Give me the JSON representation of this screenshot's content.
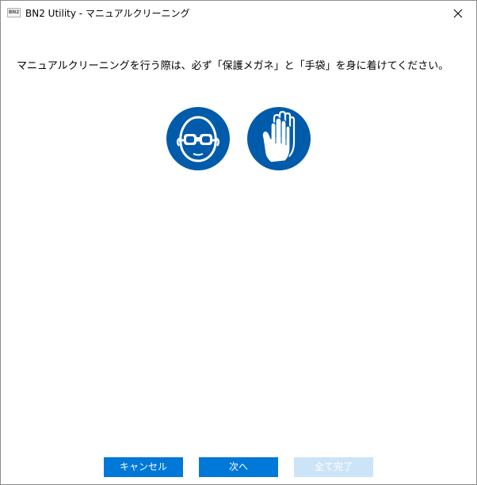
{
  "window": {
    "icon_text": "BN2",
    "title": "BN2 Utility - マニュアルクリーニング"
  },
  "main": {
    "instruction": "マニュアルクリーニングを行う際は、必ず「保護メガネ」と「手袋」を身に着けてください。",
    "icons": [
      {
        "name": "safety-goggles-icon"
      },
      {
        "name": "protective-gloves-icon"
      }
    ]
  },
  "buttons": {
    "cancel": "キャンセル",
    "next": "次へ",
    "finish": "全て完了",
    "finish_enabled": false
  },
  "colors": {
    "accent": "#0078d7",
    "disabled": "#cce4f7",
    "icon_blue": "#005baa"
  }
}
